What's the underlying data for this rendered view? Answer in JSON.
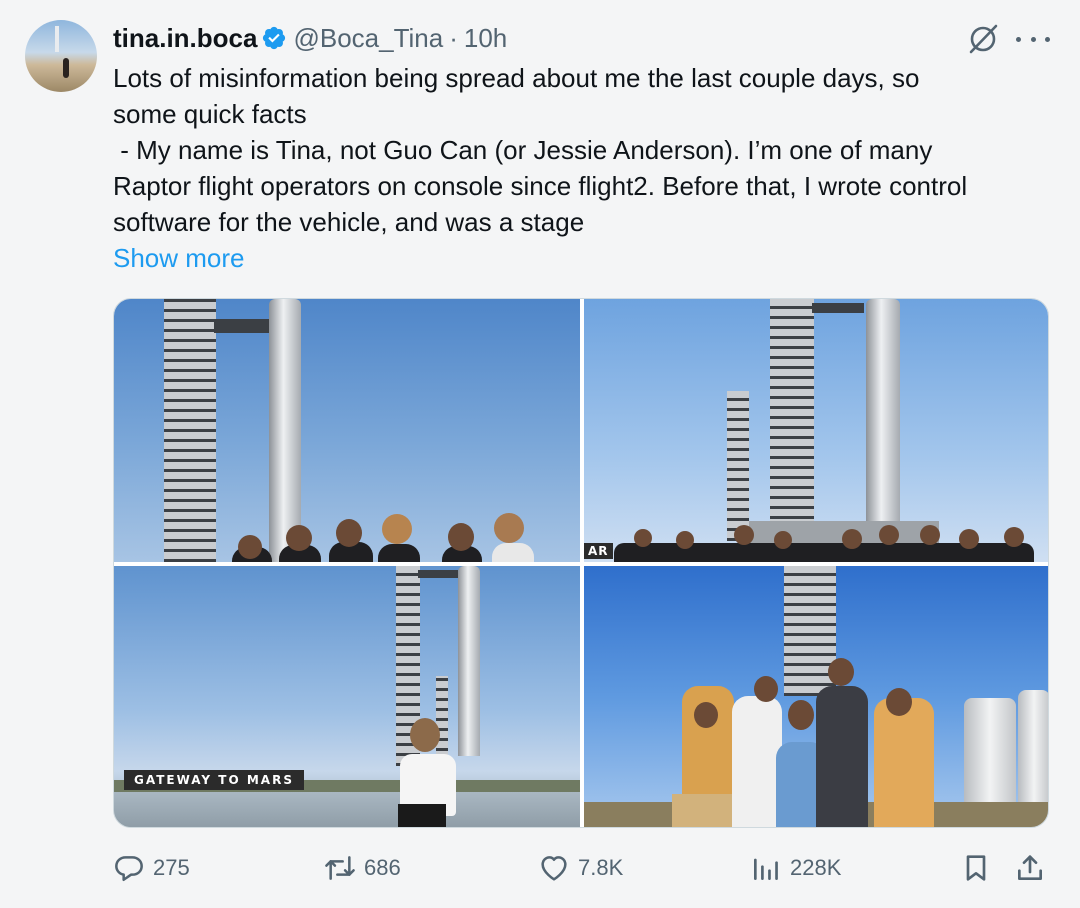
{
  "author": {
    "display_name": "tina.in.boca",
    "handle": "@Boca_Tina",
    "separator": "·",
    "time": "10h"
  },
  "tweet": {
    "lines": [
      "Lots of misinformation being spread about me the last couple days, so",
      "some quick facts",
      " - My name is Tina, not Guo Can (or Jessie Anderson). I’m one of many",
      "Raptor flight operators on console since flight2. Before that, I wrote control",
      "software for the vehicle, and was a stage"
    ],
    "show_more": "Show more"
  },
  "media": {
    "photo3_sign": "GATEWAY TO MARS",
    "photo2_sign": "AR"
  },
  "actions": {
    "replies": "275",
    "reposts": "686",
    "likes": "7.8K",
    "views": "228K"
  },
  "colors": {
    "accent": "#1d9bf0",
    "secondary_text": "#536471",
    "primary_text": "#0f1419",
    "background": "#f4f5f6"
  },
  "icons": [
    "verified-badge-icon",
    "grok-icon",
    "more-icon",
    "reply-icon",
    "repost-icon",
    "like-icon",
    "views-icon",
    "bookmark-icon",
    "share-icon"
  ]
}
